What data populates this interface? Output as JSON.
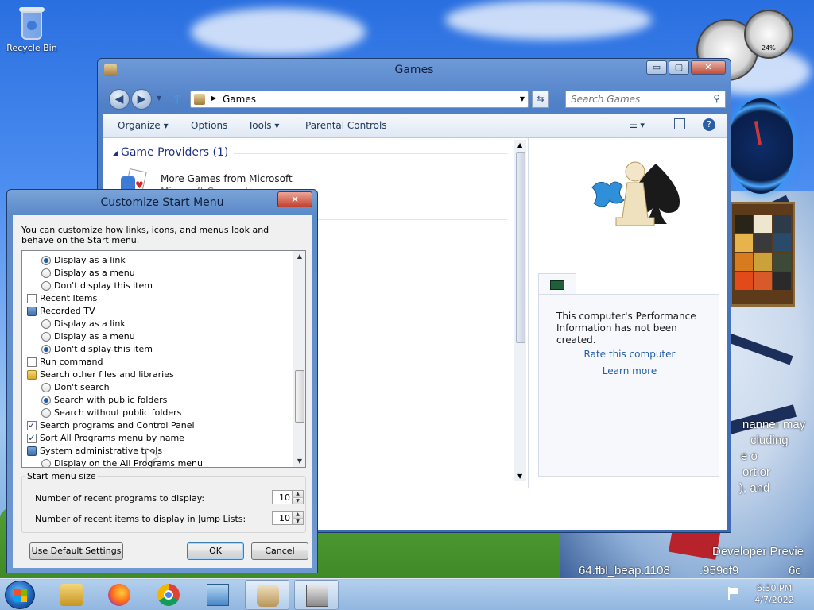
{
  "desktop": {
    "recycle_bin_label": "Recycle Bin",
    "watermark_lines": [
      "nanner may",
      "cluding",
      "e o",
      "ort or",
      "), and",
      "Developer Previe",
      "64.fbl_beap.1108",
      ".959cf9",
      "6c"
    ]
  },
  "gadgets": {
    "meter_percent": "24%"
  },
  "explorer": {
    "title": "Games",
    "address_path": "Games",
    "search_placeholder": "Search Games",
    "commands": {
      "organize": "Organize",
      "options": "Options",
      "tools": "Tools",
      "parental_controls": "Parental Controls"
    },
    "section_title": "Game Providers (1)",
    "item": {
      "title": "More Games from Microsoft",
      "subtitle": "Microsoft Corporation"
    },
    "preview": {
      "perf_text": "This computer's Performance Information has not been created.",
      "rate_link": "Rate this computer",
      "learn_link": "Learn more"
    },
    "controls": {
      "minimize": "▭",
      "maximize": "▢",
      "close": "✕"
    }
  },
  "dialog": {
    "title": "Customize Start Menu",
    "close": "✕",
    "intro": "You can customize how links, icons, and menus look and behave on the Start menu.",
    "options": [
      {
        "kind": "radio",
        "label": "Display as a link",
        "checked": true
      },
      {
        "kind": "radio",
        "label": "Display as a menu",
        "checked": false
      },
      {
        "kind": "radio",
        "label": "Don't display this item",
        "checked": false
      },
      {
        "kind": "check",
        "label": "Recent Items",
        "checked": false
      },
      {
        "kind": "category",
        "label": "Recorded TV",
        "icon": "tv-icon"
      },
      {
        "kind": "radio",
        "label": "Display as a link",
        "checked": false
      },
      {
        "kind": "radio",
        "label": "Display as a menu",
        "checked": false
      },
      {
        "kind": "radio",
        "label": "Don't display this item",
        "checked": true
      },
      {
        "kind": "check",
        "label": "Run command",
        "checked": false
      },
      {
        "kind": "category",
        "label": "Search other files and libraries",
        "icon": "folder-icon"
      },
      {
        "kind": "radio",
        "label": "Don't search",
        "checked": false
      },
      {
        "kind": "radio",
        "label": "Search with public folders",
        "checked": true
      },
      {
        "kind": "radio",
        "label": "Search without public folders",
        "checked": false
      },
      {
        "kind": "check",
        "label": "Search programs and Control Panel",
        "checked": true
      },
      {
        "kind": "check",
        "label": "Sort All Programs menu by name",
        "checked": true
      },
      {
        "kind": "category",
        "label": "System administrative tools",
        "icon": "admin-tools-icon"
      },
      {
        "kind": "radio",
        "label": "Display on the All Programs menu",
        "checked": false
      }
    ],
    "start_menu_size": {
      "title": "Start menu size",
      "recent_programs_label": "Number of recent programs to display:",
      "recent_programs_value": "10",
      "recent_items_label": "Number of recent items to display in Jump Lists:",
      "recent_items_value": "10"
    },
    "buttons": {
      "default_settings": "Use Default Settings",
      "ok": "OK",
      "cancel": "Cancel"
    }
  },
  "taskbar": {
    "time": "6:30 PM",
    "date": "4/7/2022"
  }
}
